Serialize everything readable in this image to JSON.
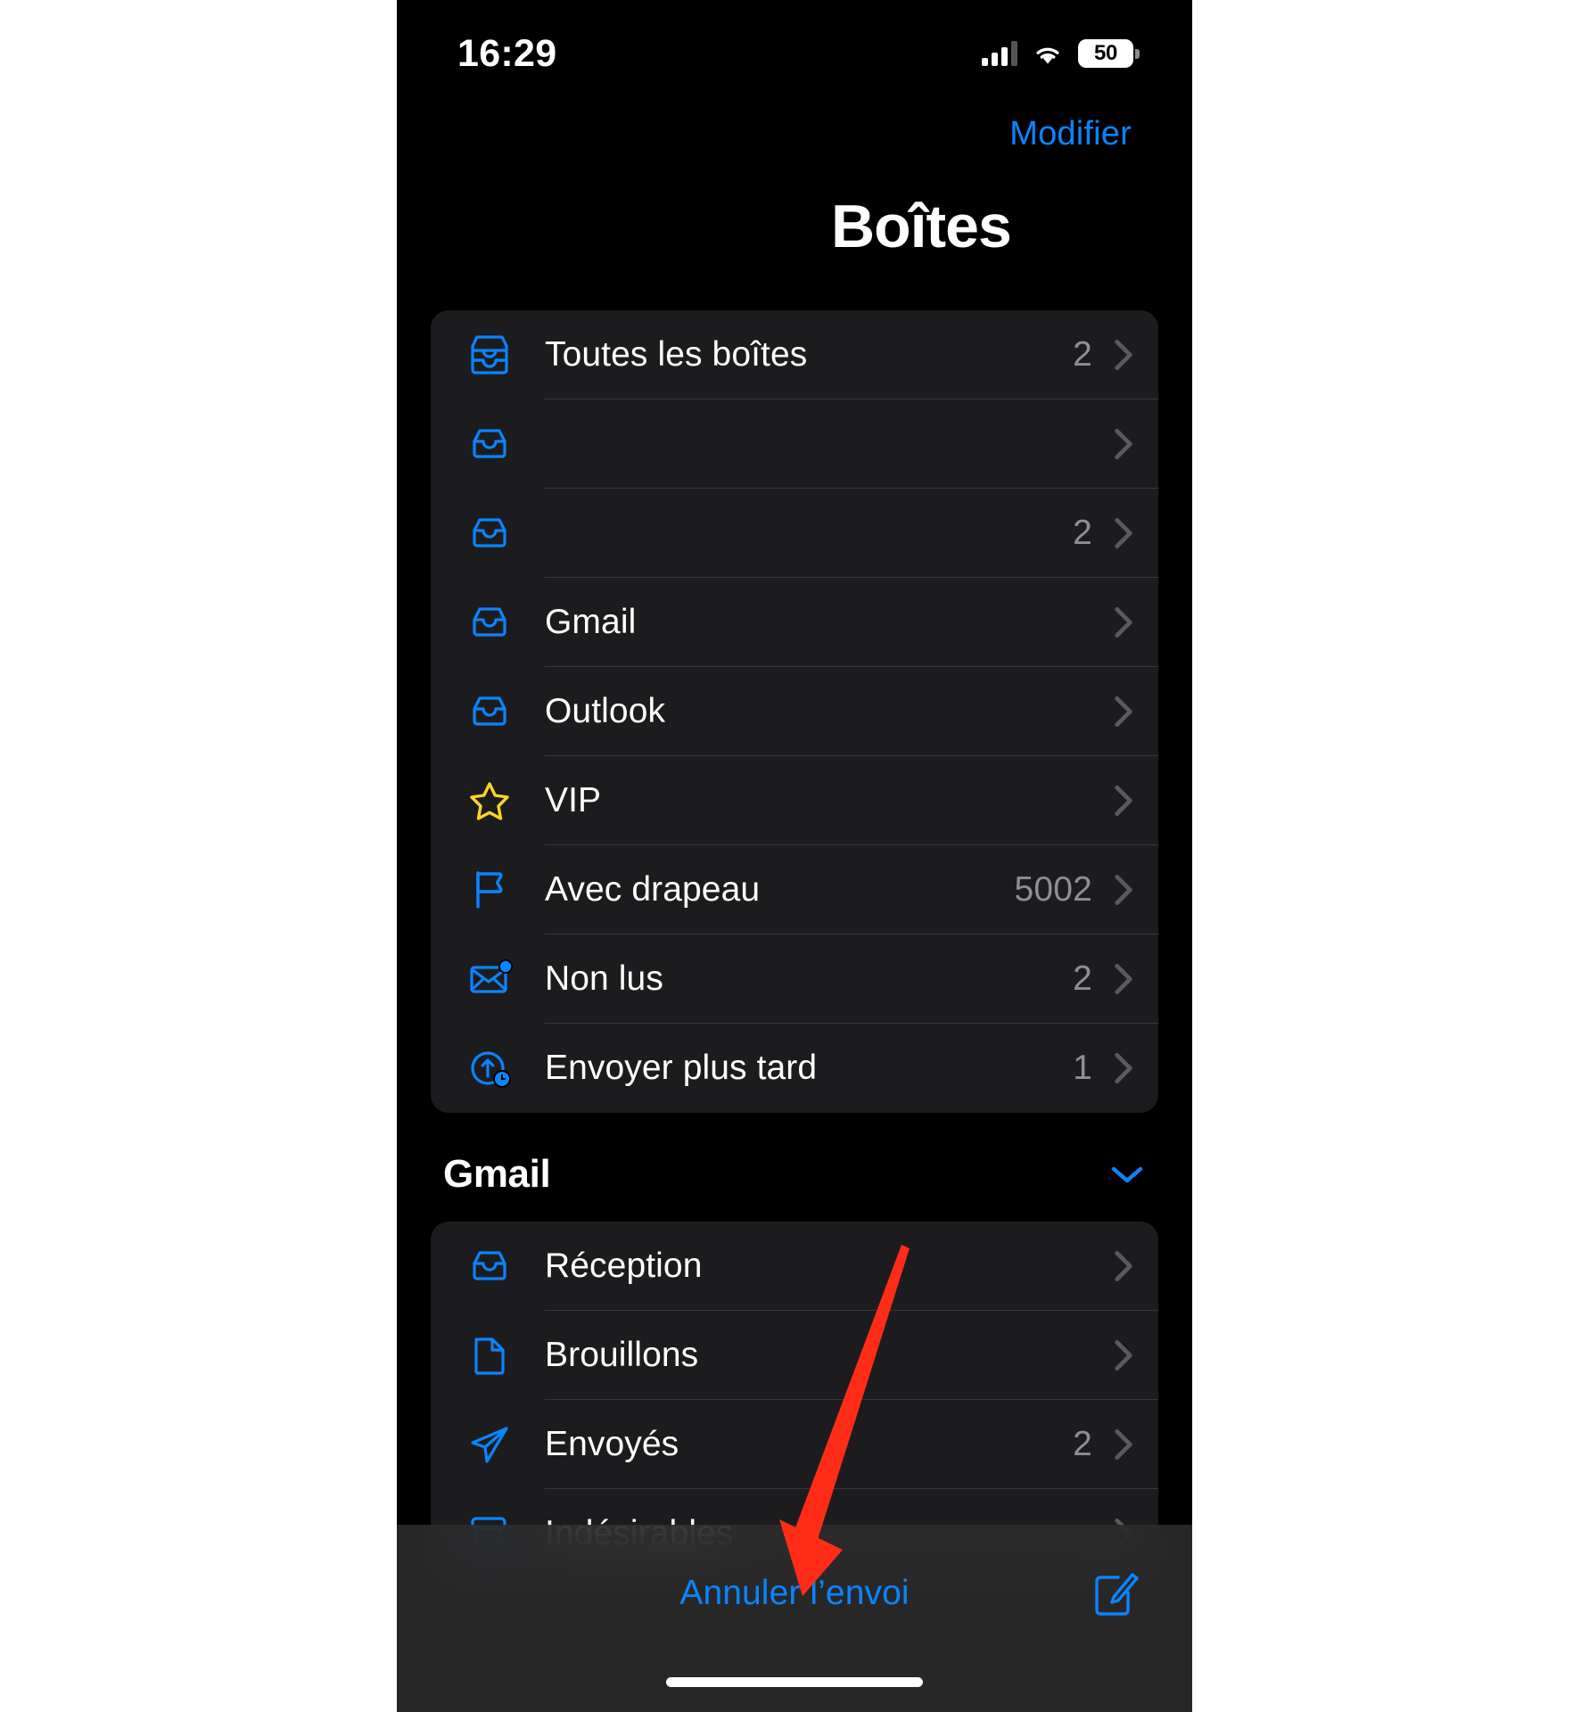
{
  "status_bar": {
    "time": "16:29",
    "battery_percent": "50",
    "cellular_icon": "cellular-signal-icon",
    "wifi_icon": "wifi-icon",
    "battery_icon": "battery-icon",
    "signal_bars_filled": 3,
    "signal_bars_total": 4
  },
  "nav": {
    "edit_label": "Modifier"
  },
  "page": {
    "title": "Boîtes"
  },
  "mailboxes": {
    "rows": [
      {
        "label": "Toutes les boîtes",
        "count": "2",
        "icon": "all-inboxes-tray-icon",
        "redacted": false
      },
      {
        "label": "",
        "count": "",
        "icon": "inbox-tray-icon",
        "redacted": true
      },
      {
        "label": "",
        "count": "2",
        "icon": "inbox-tray-icon",
        "redacted": true
      },
      {
        "label": "Gmail",
        "count": "",
        "icon": "inbox-tray-icon",
        "redacted": false
      },
      {
        "label": "Outlook",
        "count": "",
        "icon": "inbox-tray-icon",
        "redacted": false
      },
      {
        "label": "VIP",
        "count": "",
        "icon": "star-icon",
        "redacted": false
      },
      {
        "label": "Avec drapeau",
        "count": "5002",
        "icon": "flag-icon",
        "redacted": false
      },
      {
        "label": "Non lus",
        "count": "2",
        "icon": "unread-envelope-icon",
        "redacted": false
      },
      {
        "label": "Envoyer plus tard",
        "count": "1",
        "icon": "send-later-clock-icon",
        "redacted": false
      }
    ]
  },
  "gmail_section": {
    "title": "Gmail",
    "collapse_icon": "chevron-down-icon",
    "rows": [
      {
        "label": "Réception",
        "count": "",
        "icon": "inbox-tray-icon"
      },
      {
        "label": "Brouillons",
        "count": "",
        "icon": "document-icon"
      },
      {
        "label": "Envoyés",
        "count": "2",
        "icon": "paper-plane-icon"
      },
      {
        "label": "Indésirables",
        "count": "",
        "icon": "junk-trash-icon"
      }
    ]
  },
  "toolbar": {
    "undo_send_label": "Annuler l’envoi",
    "compose_icon": "compose-pencil-icon"
  },
  "annotation": {
    "type": "red-arrow",
    "color": "#FF2D17",
    "points_to": "Annuler l’envoi"
  },
  "colors": {
    "accent_blue": "#0A84FF",
    "star_yellow": "#FFD426",
    "background": "#000000",
    "group_background": "#1C1C1E",
    "secondary_text": "#8E8E93",
    "separator": "#38383A",
    "annotation_red": "#FF2D17"
  }
}
